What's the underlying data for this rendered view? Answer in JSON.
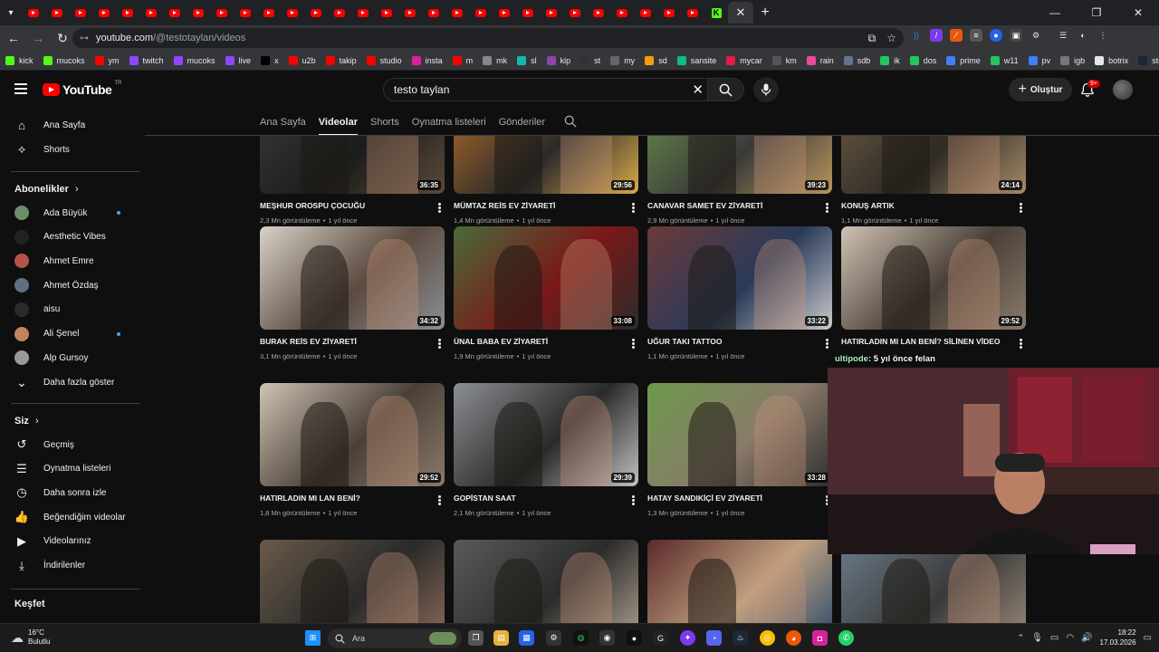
{
  "browser": {
    "tab_count_youtube_before": 30,
    "active_tab_close": "✕",
    "new_tab": "+",
    "url_host": "youtube.com",
    "url_path": "/@testotaylan/videos",
    "bookmarks": [
      {
        "label": "kick",
        "icon": "kick-icon",
        "color": "#53fc18"
      },
      {
        "label": "mucoks",
        "icon": "kick-icon",
        "color": "#53fc18"
      },
      {
        "label": "ym",
        "icon": "youtube-music-icon",
        "color": "#ff0000"
      },
      {
        "label": "twitch",
        "icon": "twitch-icon",
        "color": "#9146ff"
      },
      {
        "label": "mucoks",
        "icon": "twitch-icon",
        "color": "#9146ff"
      },
      {
        "label": "live",
        "icon": "twitch-icon",
        "color": "#9146ff"
      },
      {
        "label": "x",
        "icon": "x-icon",
        "color": "#000000"
      },
      {
        "label": "u2b",
        "icon": "youtube-icon",
        "color": "#ff0000"
      },
      {
        "label": "takip",
        "icon": "youtube-icon",
        "color": "#ff0000"
      },
      {
        "label": "studio",
        "icon": "youtube-studio-icon",
        "color": "#ff0000"
      },
      {
        "label": "insta",
        "icon": "instagram-icon",
        "color": "#d6249f"
      },
      {
        "label": "m",
        "icon": "youtube-icon",
        "color": "#ff0000"
      },
      {
        "label": "mk",
        "icon": "chart-icon",
        "color": "#888888"
      },
      {
        "label": "sl",
        "icon": "sl-icon",
        "color": "#14b8a6"
      },
      {
        "label": "kip",
        "icon": "kip-icon",
        "color": "#8e44ad"
      },
      {
        "label": "st",
        "icon": "github-icon",
        "color": "#333333"
      },
      {
        "label": "my",
        "icon": "globe-icon",
        "color": "#666666"
      },
      {
        "label": "sd",
        "icon": "s-icon",
        "color": "#f59e0b"
      },
      {
        "label": "sansite",
        "icon": "s-icon",
        "color": "#10b981"
      },
      {
        "label": "mycar",
        "icon": "car-icon",
        "color": "#e11d48"
      },
      {
        "label": "km",
        "icon": "k-icon",
        "color": "#555555"
      },
      {
        "label": "rain",
        "icon": "rain-icon",
        "color": "#ec4899"
      },
      {
        "label": "sdb",
        "icon": "sdb-icon",
        "color": "#64748b"
      },
      {
        "label": "ik",
        "icon": "power-icon",
        "color": "#22c55e"
      },
      {
        "label": "dos",
        "icon": "power-icon",
        "color": "#22c55e"
      },
      {
        "label": "prime",
        "icon": "prime-icon",
        "color": "#3b82f6"
      },
      {
        "label": "w11",
        "icon": "power-icon",
        "color": "#22c55e"
      },
      {
        "label": "pv",
        "icon": "prime-icon",
        "color": "#3b82f6"
      },
      {
        "label": "igb",
        "icon": "igb-icon",
        "color": "#777777"
      },
      {
        "label": "botrix",
        "icon": "diamond-icon",
        "color": "#e5e7eb"
      },
      {
        "label": "steam",
        "icon": "steam-icon",
        "color": "#1b2838"
      }
    ]
  },
  "masthead": {
    "logo_text": "YouTube",
    "logo_sup": "TR",
    "search_value": "testo taylan",
    "create_label": "Oluştur",
    "notif_badge": "9+"
  },
  "sidebar": {
    "top_items": [
      {
        "label": "Ana Sayfa",
        "icon": "home-icon"
      },
      {
        "label": "Shorts",
        "icon": "shorts-icon"
      }
    ],
    "subs_heading": "Abonelikler",
    "subs": [
      {
        "label": "Ada Büyük",
        "new": true,
        "color": "#6b8e6b"
      },
      {
        "label": "Aesthetic Vibes",
        "new": false,
        "color": "#222222"
      },
      {
        "label": "Ahmet Emre",
        "new": false,
        "color": "#b4534b"
      },
      {
        "label": "Ahmet Özdaş",
        "new": false,
        "color": "#5f6f80"
      },
      {
        "label": "aisu",
        "new": false,
        "color": "#2b2b2b"
      },
      {
        "label": "Ali Şenel",
        "new": true,
        "color": "#c2855a"
      },
      {
        "label": "Alp Gursoy",
        "new": false,
        "color": "#999999"
      }
    ],
    "show_more": "Daha fazla göster",
    "you_heading": "Siz",
    "you_items": [
      {
        "label": "Geçmiş",
        "icon": "history-icon"
      },
      {
        "label": "Oynatma listeleri",
        "icon": "playlist-icon"
      },
      {
        "label": "Daha sonra izle",
        "icon": "clock-icon"
      },
      {
        "label": "Beğendiğim videolar",
        "icon": "like-icon"
      },
      {
        "label": "Videolarınız",
        "icon": "your-videos-icon"
      },
      {
        "label": "İndirilenler",
        "icon": "download-icon"
      }
    ],
    "explore_heading": "Keşfet"
  },
  "channel_tabs": [
    {
      "label": "Ana Sayfa",
      "active": false
    },
    {
      "label": "Videolar",
      "active": true
    },
    {
      "label": "Shorts",
      "active": false
    },
    {
      "label": "Oynatma listeleri",
      "active": false
    },
    {
      "label": "Gönderiler",
      "active": false
    }
  ],
  "videos": [
    {
      "title": "MEŞHUR OROSPU ÇOCUĞU",
      "duration": "36:35",
      "views": "2,3 Mn görüntüleme",
      "age": "1 yıl önce"
    },
    {
      "title": "MÜMTAZ REİS EV ZİYARETİ",
      "duration": "29:56",
      "views": "1,4 Mn görüntüleme",
      "age": "1 yıl önce"
    },
    {
      "title": "CANAVAR SAMET EV ZİYARETİ",
      "duration": "39:23",
      "views": "2,9 Mn görüntüleme",
      "age": "1 yıl önce"
    },
    {
      "title": "KONUŞ ARTIK",
      "duration": "24:14",
      "views": "1,1 Mn görüntüleme",
      "age": "1 yıl önce"
    },
    {
      "title": "BURAK REİS EV ZİYARETİ",
      "duration": "34:32",
      "views": "3,1 Mn görüntüleme",
      "age": "1 yıl önce"
    },
    {
      "title": "ÜNAL BABA EV ZİYARETİ",
      "duration": "33:08",
      "views": "1,9 Mn görüntüleme",
      "age": "1 yıl önce"
    },
    {
      "title": "UĞUR TAKI TATTOO",
      "duration": "33:22",
      "views": "1,1 Mn görüntüleme",
      "age": "1 yıl önce"
    },
    {
      "title": "HATIRLADIN MI LAN BENİ? SİLİNEN VİDEO",
      "duration": "29:52",
      "views": "",
      "age": ""
    },
    {
      "title": "HATIRLADIN MI LAN BENİ?",
      "duration": "29:52",
      "views": "1,8 Mn görüntüleme",
      "age": "1 yıl önce"
    },
    {
      "title": "GOPİSTAN SAAT",
      "duration": "29:39",
      "views": "2,1 Mn görüntüleme",
      "age": "1 yıl önce"
    },
    {
      "title": "HATAY SANDIKİÇİ EV ZİYARETİ",
      "duration": "33:28",
      "views": "1,3 Mn görüntüleme",
      "age": "1 yıl önce"
    },
    {
      "title": "",
      "duration": "",
      "views": "",
      "age": ""
    },
    {
      "title": "",
      "duration": "",
      "views": "",
      "age": ""
    },
    {
      "title": "",
      "duration": "",
      "views": "",
      "age": ""
    },
    {
      "title": "",
      "duration": "",
      "views": "",
      "age": ""
    },
    {
      "title": "",
      "duration": "",
      "views": "",
      "age": ""
    }
  ],
  "meta_separator": "•",
  "stream_overlay": {
    "name": "ultipode",
    "message": ": 5 yıl önce felan"
  },
  "taskbar": {
    "temp": "16°C",
    "condition": "Bulutlu",
    "search_placeholder": "Ara",
    "time": "18:22",
    "date": "17.03.2026"
  }
}
